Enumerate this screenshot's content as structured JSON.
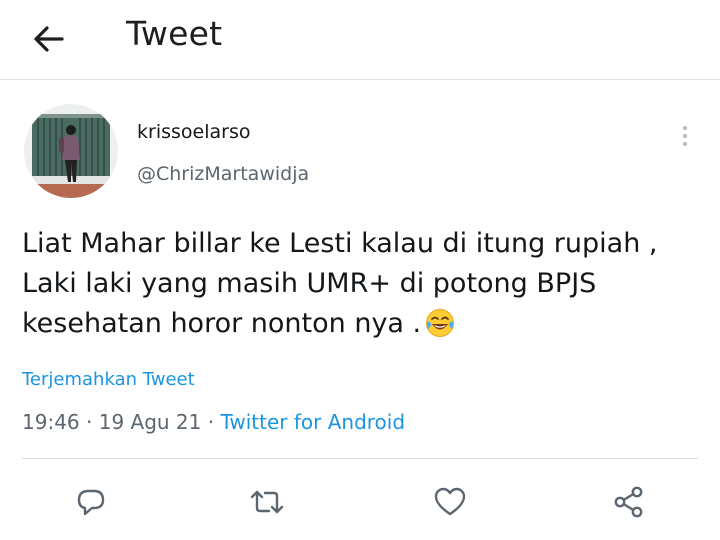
{
  "header": {
    "title": "Tweet",
    "back_icon": "arrow-left-icon"
  },
  "tweet": {
    "author": {
      "display_name": "krissoelarso",
      "handle": "@ChrizMartawidja"
    },
    "text_lines": [
      "Liat Mahar billar ke Lesti kalau di itung rupiah ,",
      "Laki laki yang masih UMR+ di potong BPJS",
      "kesehatan horor nonton nya ."
    ],
    "emoji": "face-with-tears-of-joy",
    "translate_label": "Terjemahkan Tweet",
    "time": "19:46",
    "separator": "·",
    "date": "19 Agu 21",
    "source": "Twitter for Android"
  },
  "actions": [
    {
      "name": "reply",
      "icon": "reply-icon"
    },
    {
      "name": "retweet",
      "icon": "retweet-icon"
    },
    {
      "name": "like",
      "icon": "heart-icon"
    },
    {
      "name": "share",
      "icon": "share-icon"
    }
  ],
  "colors": {
    "link": "#1b95e0",
    "text": "#14171a",
    "secondary_text": "#5b6670",
    "icon": "#5b6670",
    "divider": "#dcdfe2"
  }
}
